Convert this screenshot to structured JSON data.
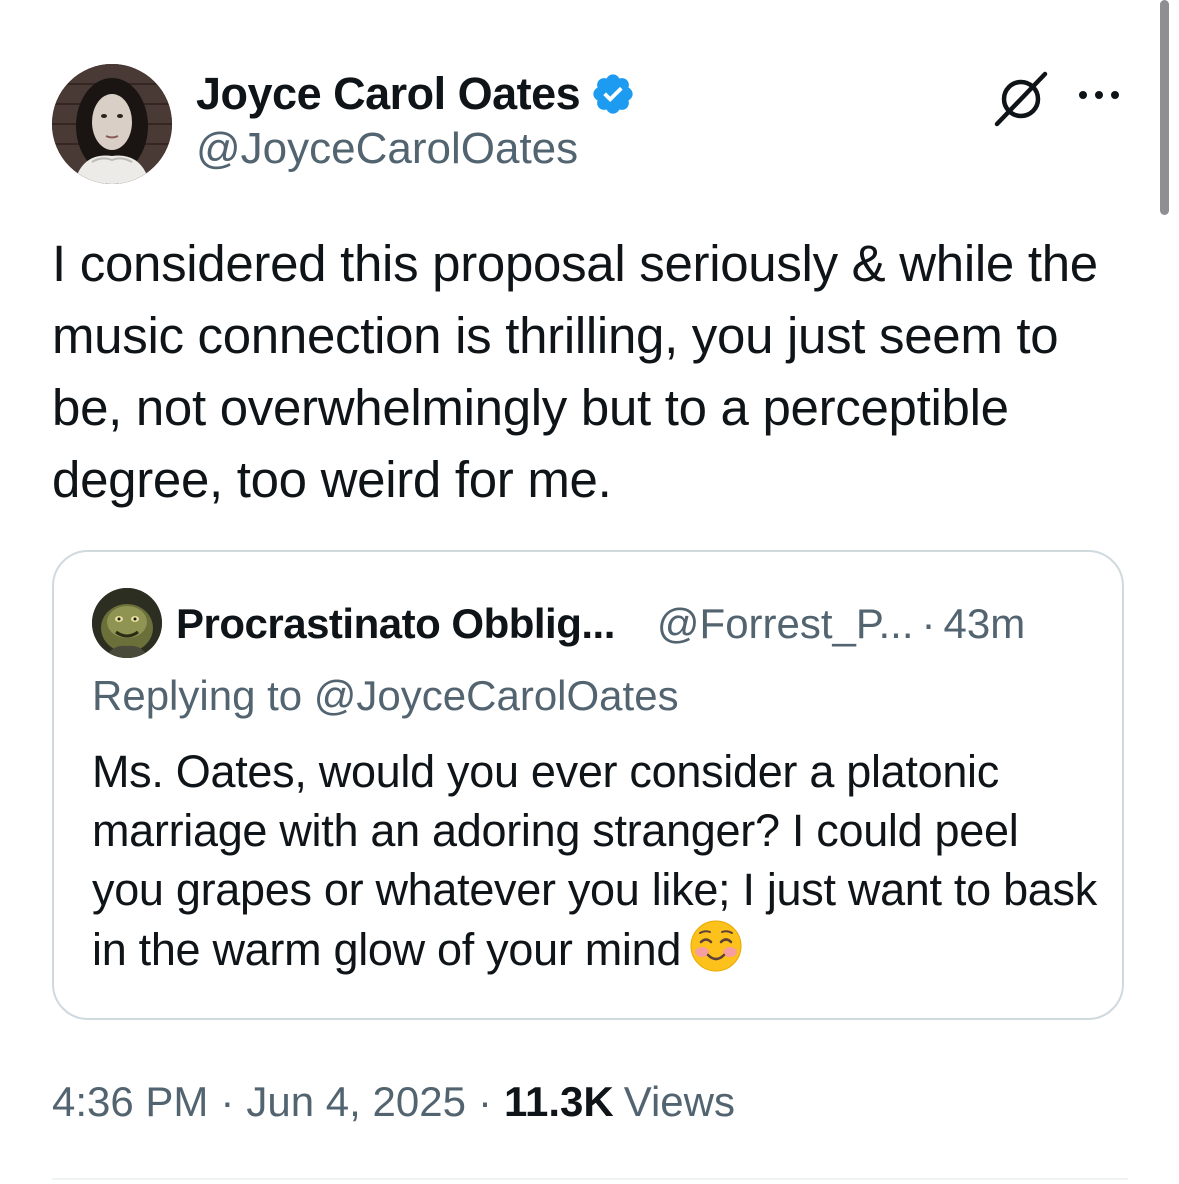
{
  "tweet": {
    "author": {
      "display_name": "Joyce Carol Oates",
      "handle": "@JoyceCarolOates",
      "verified": true,
      "avatar": "author-avatar"
    },
    "icons": {
      "grok": "grok-icon",
      "more": "more-icon",
      "verified": "verified-badge-icon"
    },
    "text": "I considered this proposal seriously & while the music connection is thrilling, you just seem to be, not overwhelmingly but to a perceptible degree, too weird for me.",
    "quoted": {
      "display_name": "Procrastinato Obblig...",
      "handle": "@Forrest_P...",
      "separator": "·",
      "time": "43m",
      "replying_to": "Replying to @JoyceCarolOates",
      "text": "Ms. Oates, would you ever consider a platonic marriage with an adoring stranger? I could peel you grapes or whatever you like; I just want to bask in the warm glow of your mind",
      "emoji": "smiling-face-with-blush-emoji"
    },
    "meta": {
      "time": "4:36 PM",
      "separator": "·",
      "date": "Jun 4, 2025",
      "views_count": "11.3K",
      "views_label": "Views"
    }
  },
  "colors": {
    "text_primary": "#0f1419",
    "text_secondary": "#536471",
    "verified_blue": "#1d9bf0",
    "card_border": "#cfd9de"
  }
}
